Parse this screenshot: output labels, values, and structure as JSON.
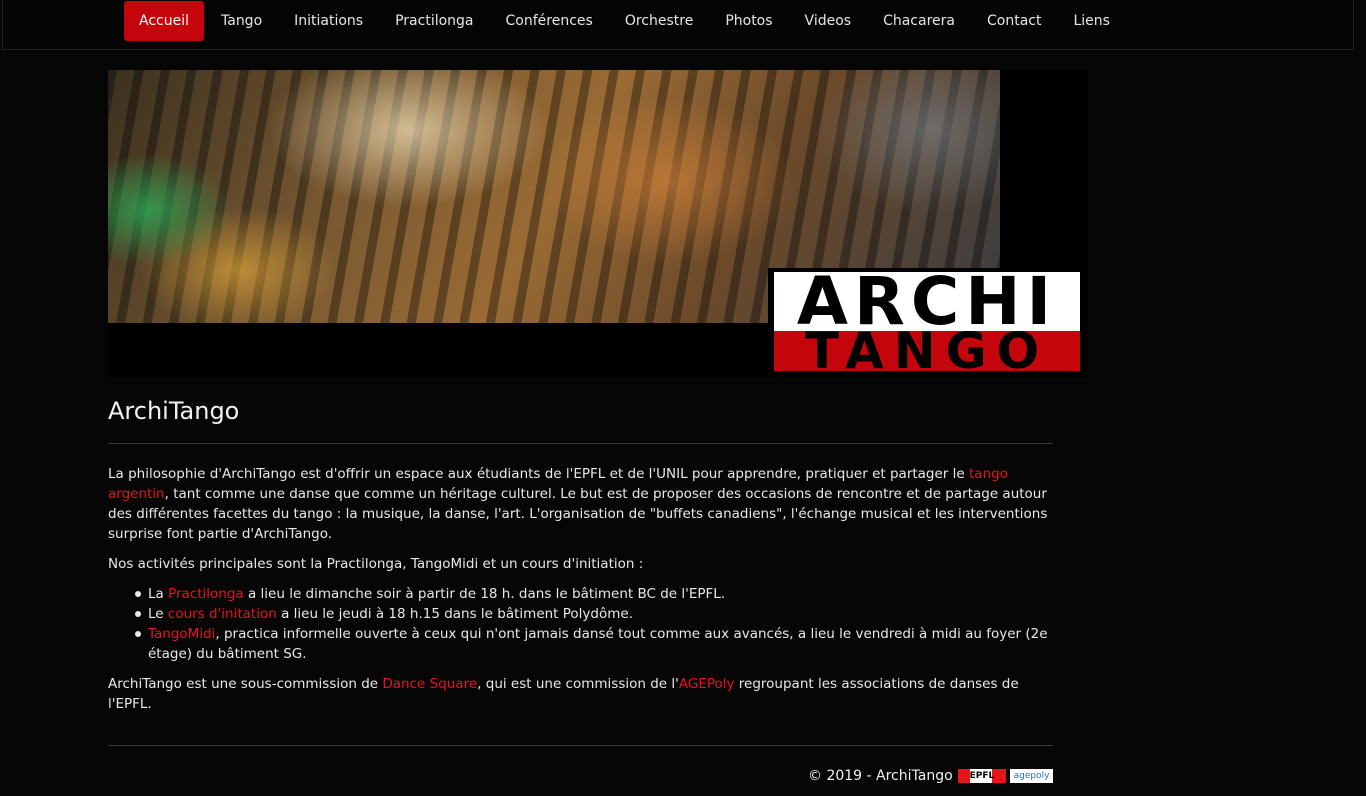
{
  "nav": {
    "items": [
      {
        "label": "Accueil",
        "active": true
      },
      {
        "label": "Tango"
      },
      {
        "label": "Initiations"
      },
      {
        "label": "Practilonga"
      },
      {
        "label": "Conférences"
      },
      {
        "label": "Orchestre"
      },
      {
        "label": "Photos"
      },
      {
        "label": "Videos"
      },
      {
        "label": "Chacarera"
      },
      {
        "label": "Contact"
      },
      {
        "label": "Liens"
      }
    ]
  },
  "banner": {
    "logo_line1": "ARCHI",
    "logo_line2": "TANGO"
  },
  "page": {
    "title": "ArchiTango"
  },
  "intro": {
    "part1": "La philosophie d'ArchiTango est d'offrir un espace aux étudiants de l'EPFL et de l'UNIL pour apprendre, pratiquer et partager le ",
    "link": "tango argentin",
    "part2": ", tant comme une danse que comme un héritage culturel. Le but est de proposer des occasions de rencontre et de partage autour des différentes facettes du tango : la musique, la danse, l'art. L'organisation de \"buffets canadiens\", l'échange musical et les interventions surprise font partie d'ArchiTango."
  },
  "activities": {
    "heading": "Nos activités principales sont la Practilonga, TangoMidi et un cours d'initiation :",
    "items": [
      {
        "before": "La ",
        "link": "Practilonga",
        "after": " a lieu le dimanche soir à partir de 18 h. dans le bâtiment BC de l'EPFL."
      },
      {
        "before": "Le ",
        "link": "cours d'initation",
        "after": " a lieu le jeudi à 18 h.15 dans le bâtiment Polydôme."
      },
      {
        "before": "",
        "link": "TangoMidi",
        "after": ", practica informelle ouverte à ceux qui n'ont jamais dansé tout comme aux avancés, a lieu le vendredi à midi au foyer (2e étage) du bâtiment SG."
      }
    ]
  },
  "commission": {
    "part1": "ArchiTango est une sous-commission de ",
    "link1": "Dance Square",
    "part2": ", qui est une commission de l'",
    "link2": "AGEPoly",
    "part3": " regroupant les associations de danses de l'EPFL."
  },
  "footer": {
    "copyright": "© 2019 - ArchiTango",
    "epfl_logo_text": "EPFL",
    "agepoly_logo_text": "agepoly"
  },
  "colors": {
    "accent": "#c4060c",
    "link": "#e8141b",
    "background": "#060606"
  }
}
